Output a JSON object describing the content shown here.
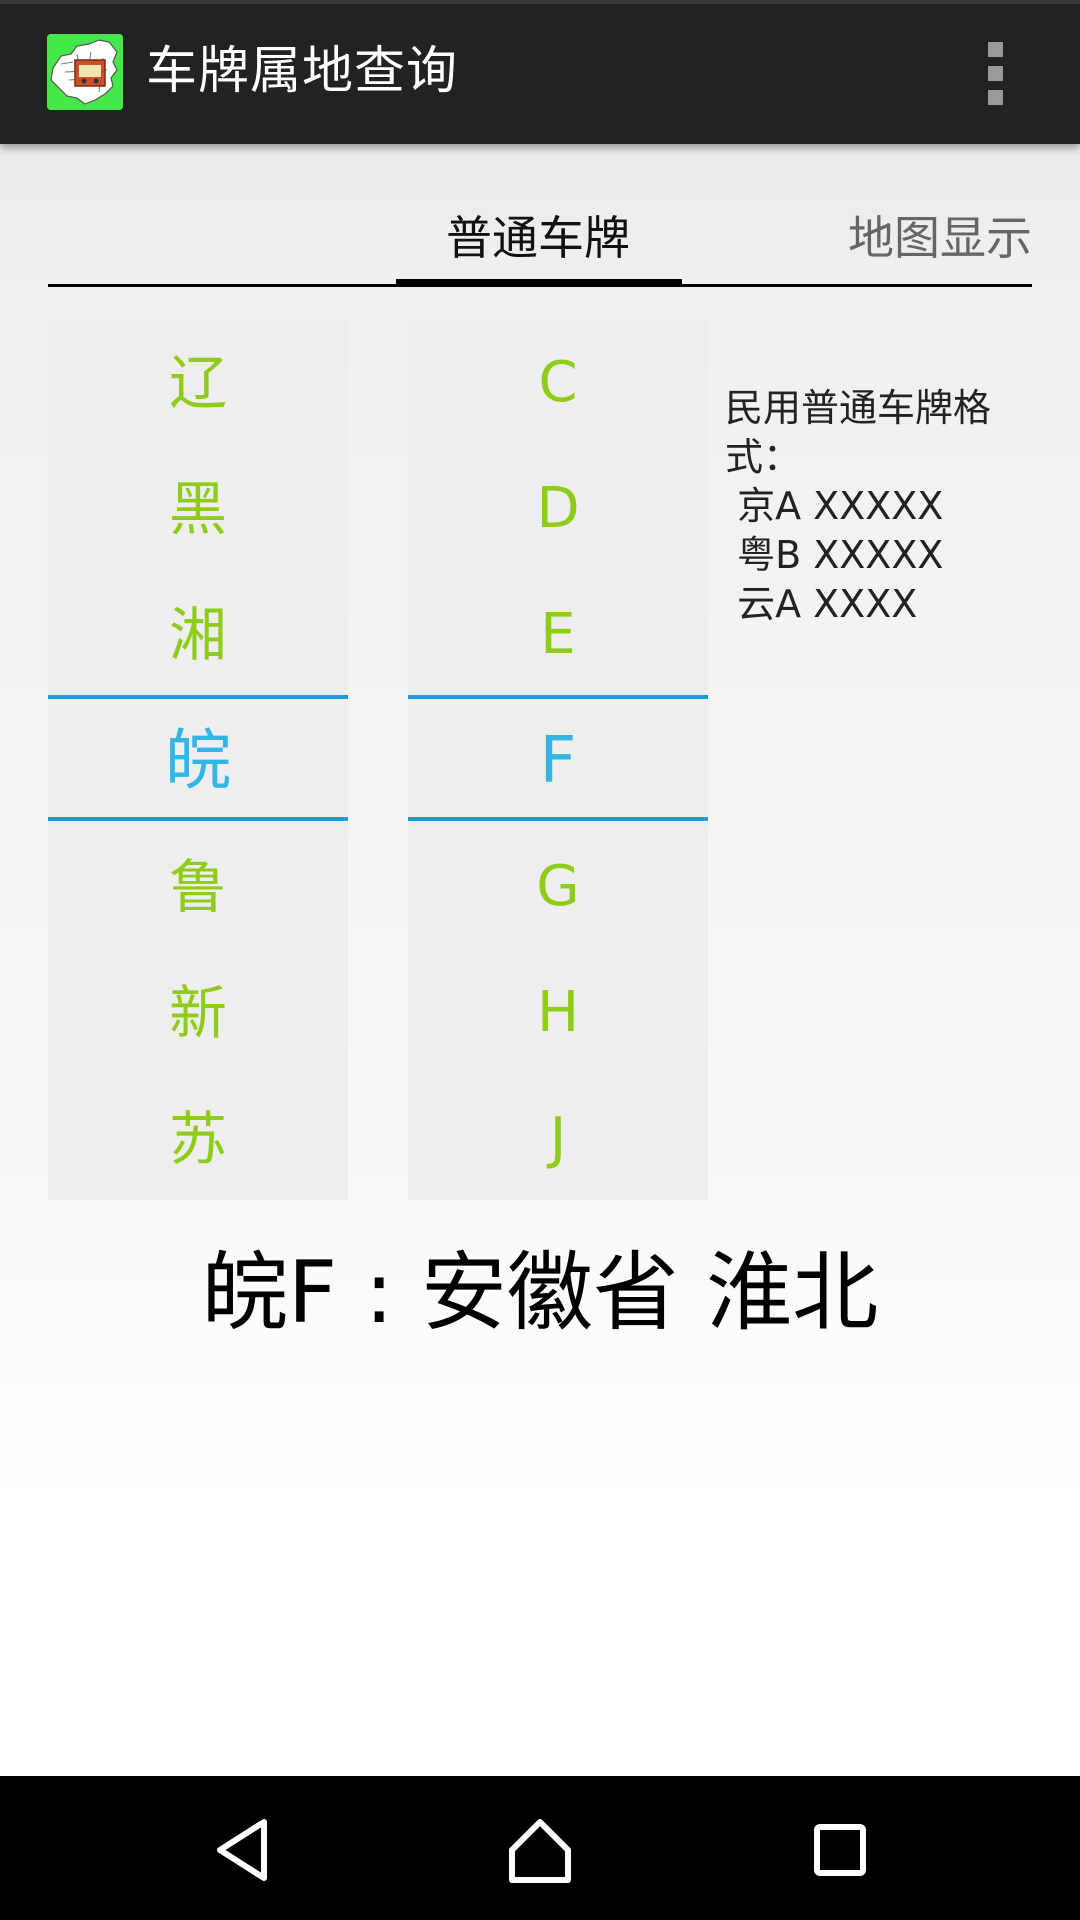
{
  "app": {
    "title": "车牌属地查询",
    "icon": "china-map-license-plate-icon",
    "colors": {
      "actionbar": "#222222",
      "icon_bg": "#44e84a"
    }
  },
  "tabs": [
    {
      "label": "普通车牌",
      "selected": true
    },
    {
      "label": "地图显示",
      "selected": false
    }
  ],
  "province_picker": {
    "items": [
      "辽",
      "黑",
      "湘",
      "皖",
      "鲁",
      "新",
      "苏"
    ],
    "selected": "皖"
  },
  "letter_picker": {
    "items": [
      "C",
      "D",
      "E",
      "F",
      "G",
      "H",
      "J"
    ],
    "selected": "F"
  },
  "format_info": {
    "heading": "民用普通车牌格式：",
    "examples": [
      " 京A XXXXX",
      " 粤B XXXXX",
      " 云A XXXX"
    ]
  },
  "result": "皖F : 安徽省 淮北",
  "colors": {
    "item": "#8fcc1a",
    "selected": "#33b5e5",
    "divider": "#1a9ad6"
  },
  "navbar": {
    "back": "back-icon",
    "home": "home-icon",
    "recents": "recents-icon"
  }
}
